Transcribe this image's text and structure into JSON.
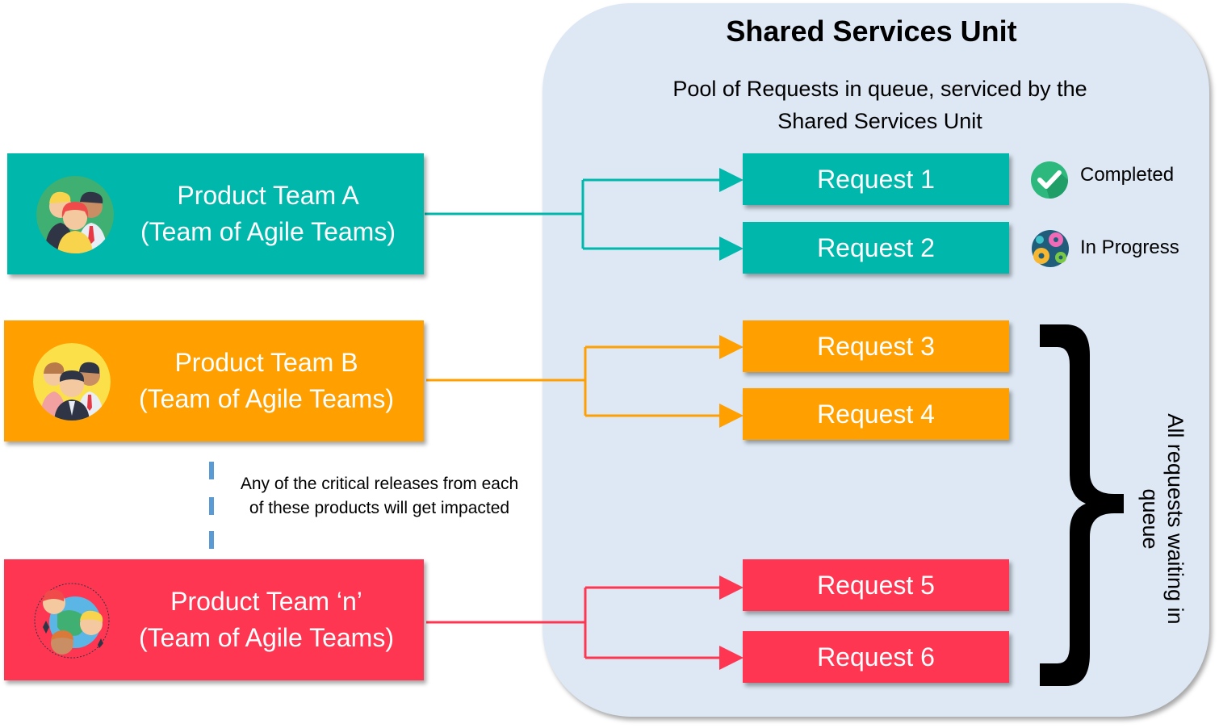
{
  "shared_services": {
    "title": "Shared Services Unit",
    "subtitle_line1": "Pool of Requests in queue, serviced by the",
    "subtitle_line2": "Shared Services Unit"
  },
  "teams": [
    {
      "line1": "Product Team A",
      "line2": "(Team of Agile Teams)",
      "color": "#00b7ac",
      "icon": "team-group-icon"
    },
    {
      "line1": "Product Team B",
      "line2": "(Team of Agile Teams)",
      "color": "#ff9f00",
      "icon": "team-group-icon"
    },
    {
      "line1": "Product Team ‘n’",
      "line2": "(Team of Agile Teams)",
      "color": "#ff3651",
      "icon": "global-team-icon"
    }
  ],
  "requests": [
    {
      "label": "Request 1",
      "team": 0
    },
    {
      "label": "Request 2",
      "team": 0
    },
    {
      "label": "Request 3",
      "team": 1
    },
    {
      "label": "Request 4",
      "team": 1
    },
    {
      "label": "Request 5",
      "team": 2
    },
    {
      "label": "Request 6",
      "team": 2
    }
  ],
  "legend": {
    "completed": {
      "label": "Completed",
      "icon": "check-circle-icon",
      "color": "#2db87d"
    },
    "in_progress": {
      "label": "In Progress",
      "icon": "gears-icon"
    }
  },
  "note": {
    "line1": "Any of the critical releases from each",
    "line2": "of these products will get impacted"
  },
  "queue_label": "All requests waiting in queue",
  "colors": {
    "panel": "#dde8f4",
    "dash": "#5b9bd5"
  }
}
